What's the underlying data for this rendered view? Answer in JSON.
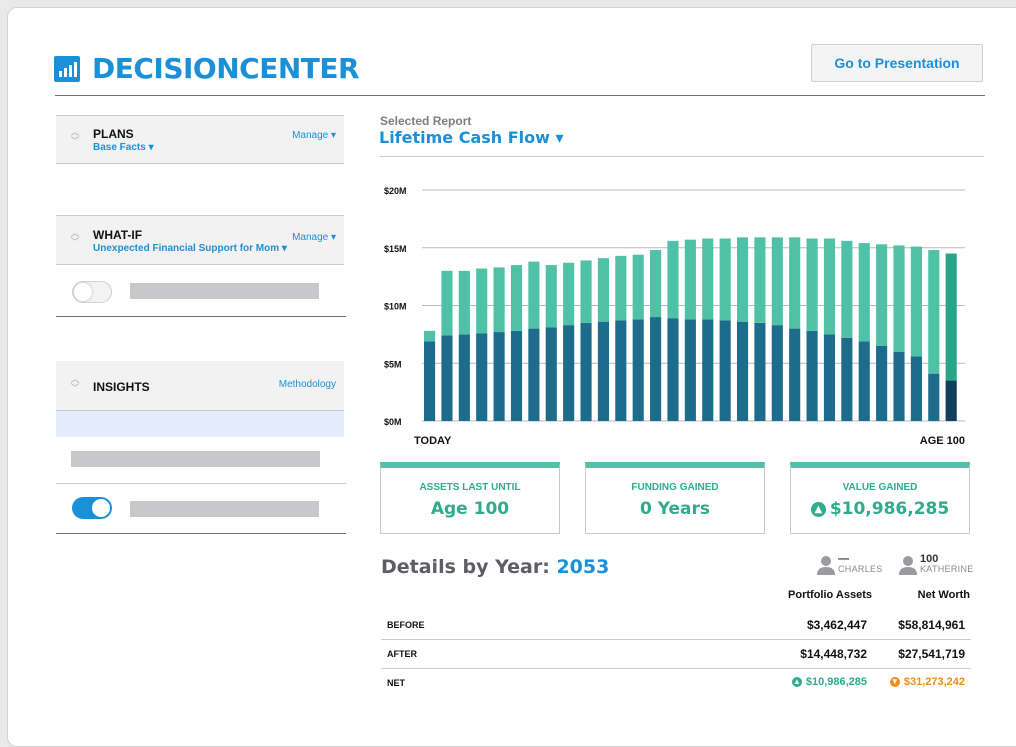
{
  "brand": {
    "name": "DECISIONCENTER",
    "color": "#1a90d9"
  },
  "header": {
    "presentation_button": "Go to Presentation"
  },
  "sidebar": {
    "plans": {
      "title": "PLANS",
      "subtitle": "Base Facts ▾",
      "link": "Manage ▾"
    },
    "what_if": {
      "title": "WHAT-IF",
      "subtitle": "Unexpected Financial Support for Mom ▾",
      "link": "Manage ▾",
      "toggle_on": false
    },
    "insights": {
      "title": "INSIGHTS",
      "link": "Methodology",
      "toggle_on": true
    }
  },
  "report": {
    "label": "Selected Report",
    "title": "Lifetime Cash Flow ▾"
  },
  "chart_data": {
    "type": "bar",
    "stacked": true,
    "title": "",
    "xlabel": "",
    "ylabel": "",
    "yticks": [
      "$0M",
      "$5M",
      "$10M",
      "$15M",
      "$20M"
    ],
    "ylim": [
      0,
      20
    ],
    "x_start_label": "TODAY",
    "x_end_label": "AGE 100",
    "grid": true,
    "series": [
      {
        "values": [
          6.9,
          7.4,
          7.5,
          7.6,
          7.7,
          7.8,
          8.0,
          8.1,
          8.3,
          8.5,
          8.6,
          8.7,
          8.8,
          9.0,
          8.9,
          8.8,
          8.8,
          8.7,
          8.6,
          8.5,
          8.3,
          8.0,
          7.8,
          7.5,
          7.2,
          6.9,
          6.5,
          6.0,
          5.6,
          4.1,
          3.5
        ],
        "color": "#1e6c8c"
      },
      {
        "values": [
          0.9,
          5.6,
          5.5,
          5.6,
          5.6,
          5.7,
          5.8,
          5.4,
          5.4,
          5.4,
          5.5,
          5.6,
          5.6,
          5.8,
          6.7,
          6.9,
          7.0,
          7.1,
          7.3,
          7.4,
          7.6,
          7.9,
          8.0,
          8.3,
          8.4,
          8.5,
          8.8,
          9.2,
          9.5,
          10.7,
          11.0
        ],
        "color": "#4fc1a6"
      }
    ]
  },
  "cards": [
    {
      "label": "ASSETS LAST UNTIL",
      "value": "Age 100"
    },
    {
      "label": "FUNDING GAINED",
      "value": "0 Years"
    },
    {
      "label": "VALUE GAINED",
      "value": "$10,986,285",
      "icon": "up-circle-icon"
    }
  ],
  "details": {
    "title": "Details by Year:",
    "year": "2053",
    "people": [
      {
        "value": "—",
        "name": "CHARLES"
      },
      {
        "value": "100",
        "name": "KATHERINE"
      }
    ],
    "columns": [
      "Portfolio Assets",
      "Net Worth"
    ],
    "rows": [
      {
        "label": "BEFORE",
        "c1": "$3,462,447",
        "c2": "$58,814,961"
      },
      {
        "label": "AFTER",
        "c1": "$14,448,732",
        "c2": "$27,541,719"
      },
      {
        "label": "NET",
        "c1": "$10,986,285",
        "c2": "$31,273,242",
        "c1_color": "#2fab8e",
        "c2_color": "#f08c1b"
      }
    ]
  }
}
